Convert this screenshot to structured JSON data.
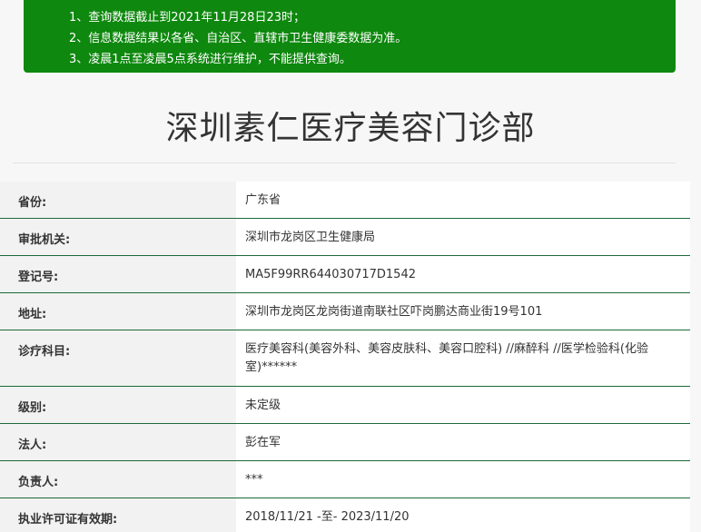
{
  "notice": {
    "lines": [
      "1、查询数据截止到2021年11月28日23时；",
      "2、信息数据结果以各省、自治区、直辖市卫生健康委数据为准。",
      "3、凌晨1点至凌晨5点系统进行维护，不能提供查询。"
    ],
    "background": "#0e880e"
  },
  "title": "深圳素仁医疗美容门诊部",
  "rows": [
    {
      "label": "省份:",
      "value": "广东省"
    },
    {
      "label": "审批机关:",
      "value": "深圳市龙岗区卫生健康局"
    },
    {
      "label": "登记号:",
      "value": "MA5F99RR644030717D1542"
    },
    {
      "label": "地址:",
      "value": "深圳市龙岗区龙岗街道南联社区吓岗鹏达商业街19号101"
    },
    {
      "label": "诊疗科目:",
      "value": "医疗美容科(美容外科、美容皮肤科、美容口腔科) //麻醉科 //医学检验科(化验室)******"
    },
    {
      "label": "级别:",
      "value": "未定级"
    },
    {
      "label": "法人:",
      "value": "彭在军"
    },
    {
      "label": "负责人:",
      "value": "***"
    },
    {
      "label": "执业许可证有效期:",
      "value": "2018/11/21 -至- 2023/11/20"
    }
  ],
  "colors": {
    "accent": "#0e880e",
    "row_border": "#1c6a3a"
  }
}
